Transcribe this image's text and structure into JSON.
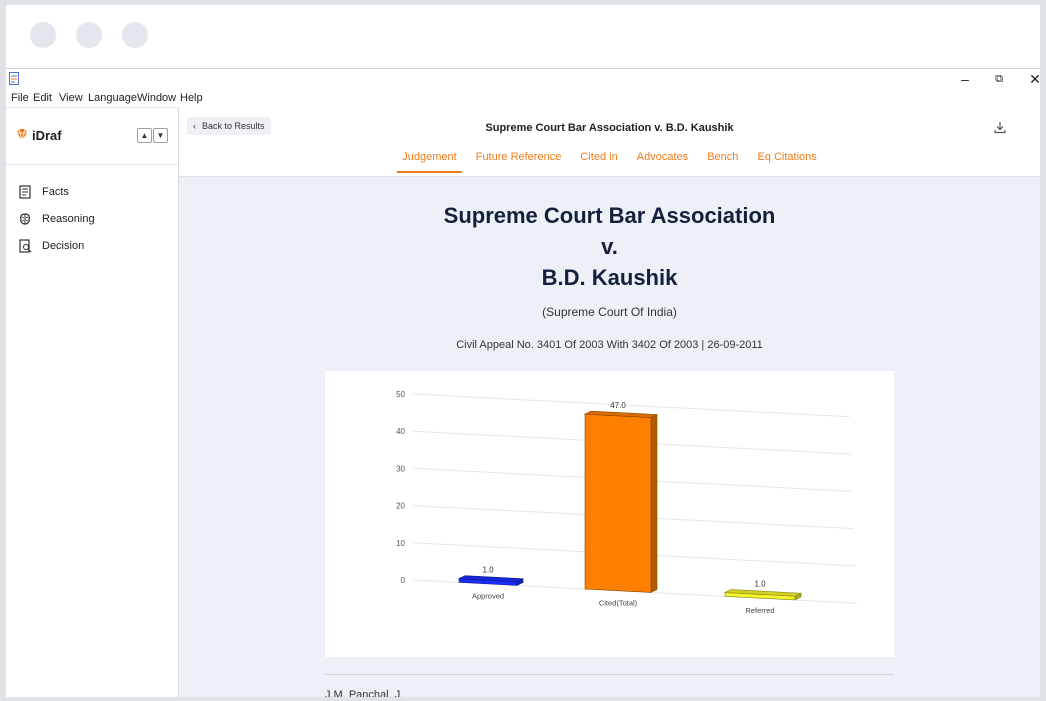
{
  "window": {
    "menu": [
      "File",
      "Edit",
      "View",
      "Language",
      "Window",
      "Help"
    ],
    "controls": {
      "minimize": "–",
      "restore": "⧉",
      "close": "✕"
    }
  },
  "sidebar": {
    "brand": "iDraf",
    "items": [
      {
        "label": "Facts",
        "icon": "document-icon"
      },
      {
        "label": "Reasoning",
        "icon": "brain-icon"
      },
      {
        "label": "Decision",
        "icon": "decision-icon"
      }
    ]
  },
  "header": {
    "back_label": "Back to Results",
    "case_title": "Supreme Court Bar Association v. B.D. Kaushik",
    "tabs": [
      "Judgement",
      "Future Reference",
      "Cited in",
      "Advocates",
      "Bench",
      "Eq Citations"
    ],
    "active_tab": "Judgement"
  },
  "case": {
    "line1": "Supreme Court Bar Association",
    "line2": "v.",
    "line3": "B.D. Kaushik",
    "court": "(Supreme Court Of India)",
    "citation": "Civil Appeal No. 3401 Of 2003 With 3402 Of 2003 | 26-09-2011",
    "judge": "J.M. Panchal, J."
  },
  "chart_data": {
    "type": "bar",
    "style": "3d",
    "categories": [
      "Approved",
      "Cited(Total)",
      "Referred"
    ],
    "values": [
      1.0,
      47.0,
      1.0
    ],
    "value_labels": [
      "1.0",
      "47.0",
      "1.0"
    ],
    "colors": [
      "#1a2fff",
      "#ff8000",
      "#f6f62a"
    ],
    "yticks": [
      "0",
      "10",
      "20",
      "30",
      "40",
      "50"
    ],
    "ylim": [
      0,
      50
    ],
    "grid": true,
    "legend": "none"
  },
  "colors": {
    "accent": "#f07a17",
    "title": "#14213d",
    "content_bg": "#edf1f7"
  }
}
